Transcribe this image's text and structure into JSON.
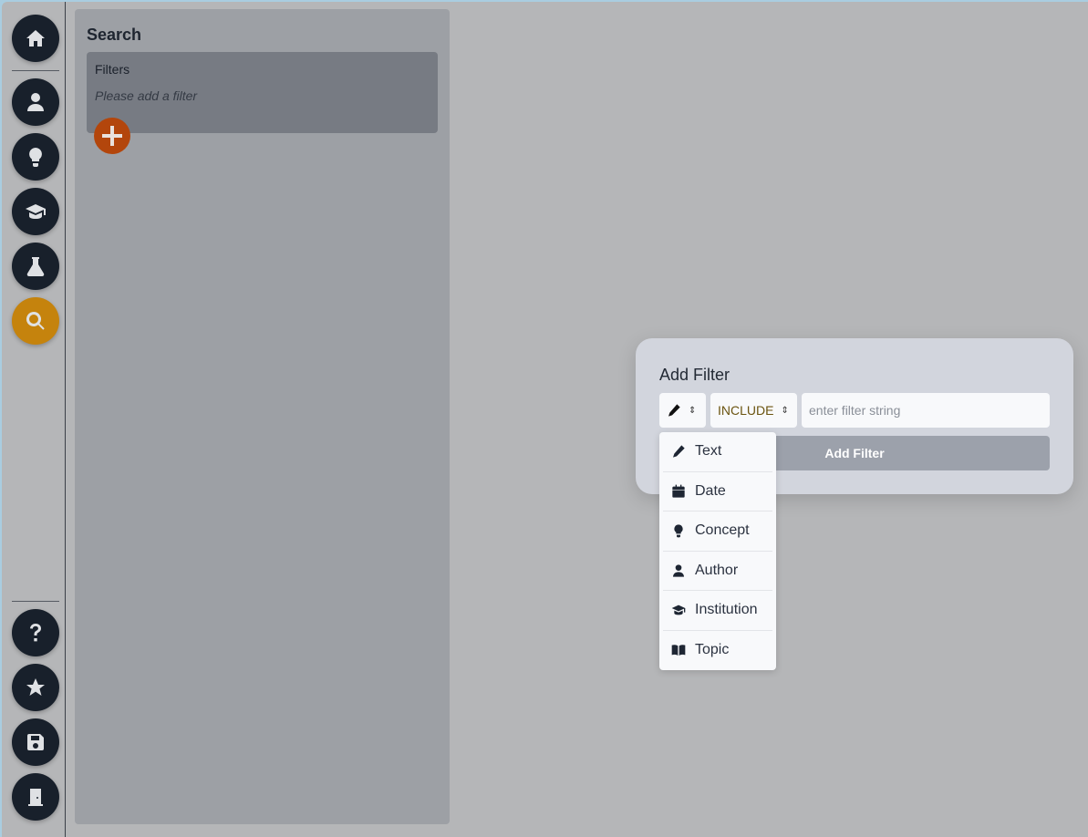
{
  "sidebar": {
    "top_items": [
      {
        "icon": "home-icon"
      },
      {
        "icon": "user-icon"
      },
      {
        "icon": "lightbulb-icon"
      },
      {
        "icon": "graduation-cap-icon"
      },
      {
        "icon": "flask-icon"
      },
      {
        "icon": "search-icon",
        "active": true
      }
    ],
    "bottom_items": [
      {
        "icon": "question-icon"
      },
      {
        "icon": "star-icon"
      },
      {
        "icon": "save-icon"
      },
      {
        "icon": "door-exit-icon"
      }
    ],
    "active_color": "#c5830d"
  },
  "search_panel": {
    "title": "Search",
    "filters_title": "Filters",
    "empty_text": "Please add a filter",
    "add_button_color": "#b3460c"
  },
  "modal": {
    "title": "Add Filter",
    "type_select": {
      "selected_icon": "pencil-icon"
    },
    "mode_select": {
      "value": "INCLUDE"
    },
    "filter_input": {
      "placeholder": "enter filter string",
      "value": ""
    },
    "submit_label": "Add Filter"
  },
  "type_menu": {
    "items": [
      {
        "label": "Text",
        "icon": "pencil-icon"
      },
      {
        "label": "Date",
        "icon": "calendar-icon"
      },
      {
        "label": "Concept",
        "icon": "lightbulb-icon"
      },
      {
        "label": "Author",
        "icon": "user-icon"
      },
      {
        "label": "Institution",
        "icon": "graduation-cap-icon"
      },
      {
        "label": "Topic",
        "icon": "book-icon"
      }
    ]
  }
}
